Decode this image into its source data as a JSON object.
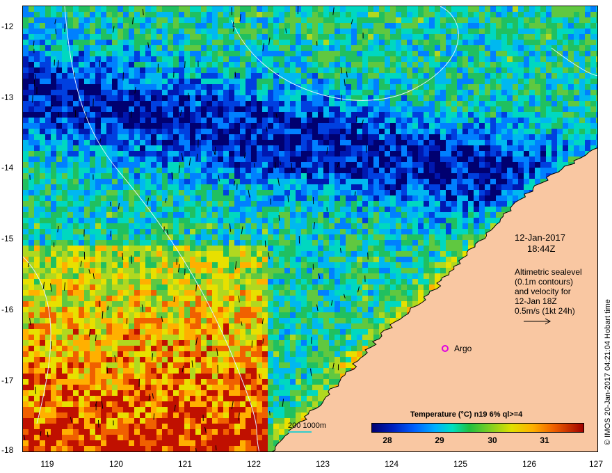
{
  "map": {
    "lon_ticks": [
      "119",
      "120",
      "121",
      "122",
      "123",
      "124",
      "125",
      "126",
      "127"
    ],
    "lat_ticks": [
      "-12",
      "-13",
      "-14",
      "-15",
      "-16",
      "-17",
      "-18"
    ],
    "lon_range": [
      118.65,
      127
    ],
    "lat_range": [
      -11.73,
      -18
    ],
    "land_color": "#f9c7a2",
    "coast_color": "#000000",
    "contour_color": "#e0f0ff"
  },
  "date": {
    "line1": "12-Jan-2017",
    "line2": "18:44Z"
  },
  "altimetry": {
    "line1": "Altimetric sealevel",
    "line2": "(0.1m contours)",
    "line3": "and velocity for",
    "line4": "12-Jan 18Z",
    "line5": "0.5m/s (1kt 24h)"
  },
  "argo": {
    "label": "Argo",
    "color": "#e000e0"
  },
  "scale": {
    "label": "200  1000m"
  },
  "colorbar": {
    "title": "Temperature (°C) n19 6% ql>=4",
    "ticks": [
      "28",
      "29",
      "30",
      "31"
    ],
    "range": [
      27.6,
      31.8
    ]
  },
  "credit": "© IMOS 20-Jan-2017 04:21:04 Hobart time"
}
